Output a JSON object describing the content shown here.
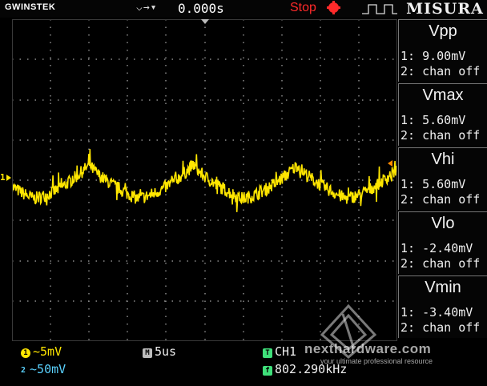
{
  "header": {
    "brand": "GWINSTEK",
    "trigger_icons": "⌵→▾",
    "trigger_time": "0.000s",
    "run_state": "Stop",
    "menu_title": "MISURA"
  },
  "channel_marker": "1",
  "measurements": [
    {
      "title": "Vpp",
      "ch1": "1: 9.00mV",
      "ch2": "2: chan off"
    },
    {
      "title": "Vmax",
      "ch1": "1: 5.60mV",
      "ch2": "2: chan off"
    },
    {
      "title": "Vhi",
      "ch1": "1: 5.60mV",
      "ch2": "2: chan off"
    },
    {
      "title": "Vlo",
      "ch1": "1: -2.40mV",
      "ch2": "2: chan off"
    },
    {
      "title": "Vmin",
      "ch1": "1: -3.40mV",
      "ch2": "2: chan off"
    }
  ],
  "footer": {
    "ch1_badge": "1",
    "ch1_scale": "~5mV",
    "ch2_badge": "2",
    "ch2_scale": "~50mV",
    "time_badge": "M",
    "time_scale": "5us",
    "trig_badge": "T",
    "trig_source": "CH1",
    "freq_badge": "f",
    "frequency": "802.290kHz"
  },
  "watermark": {
    "title": "nexthardware.com",
    "subtitle": "your ultimate professional resource"
  },
  "colors": {
    "ch1": "#ffe600",
    "ch2": "#5ad2ff",
    "stop": "#ff2a2a",
    "trigger_level": "#ff8a00",
    "grid": "#8a8a8a"
  },
  "waveform": {
    "period_divisions": 2.7,
    "peak_mv": 5.6,
    "trough_mv": -3.4,
    "volts_per_div_mv": 5
  }
}
